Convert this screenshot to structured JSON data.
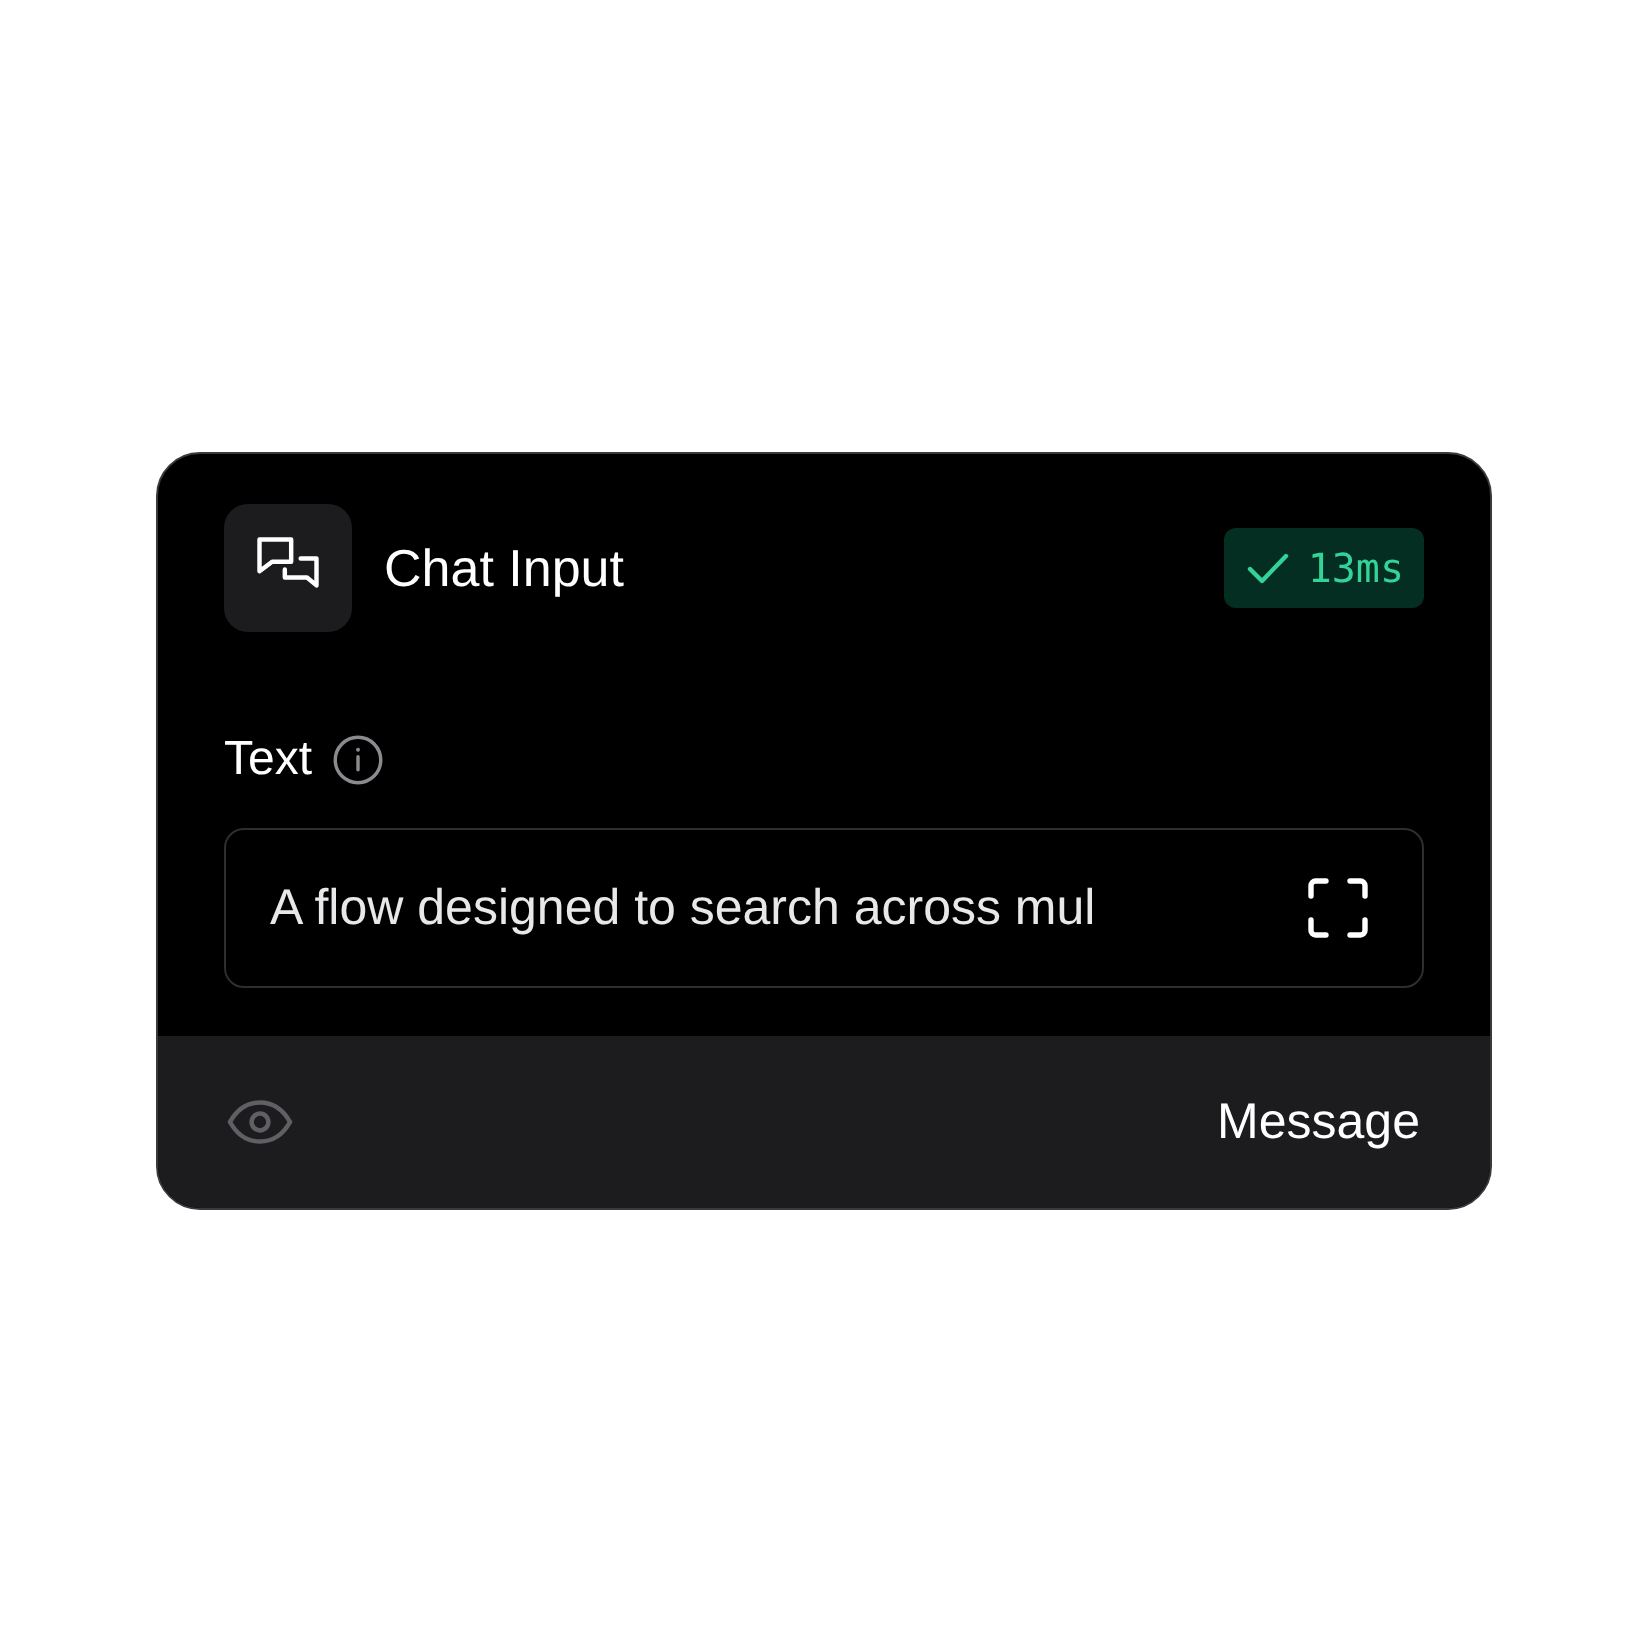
{
  "node": {
    "title": "Chat Input",
    "badge": {
      "succeeded": true,
      "label": "13ms"
    },
    "field": {
      "label": "Text",
      "value": "A flow designed to search across mul"
    },
    "footer": {
      "output": "Message"
    }
  }
}
